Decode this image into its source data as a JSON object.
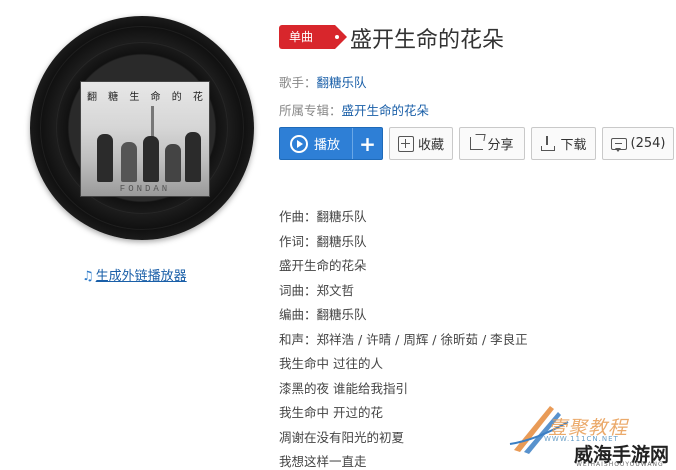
{
  "album_cover": {
    "title_text": "翻 糖 生 命 的 花 朵",
    "brand_text": "FONDAN"
  },
  "ext_player_link": "生成外链播放器",
  "song": {
    "badge": "单曲",
    "title": "盛开生命的花朵",
    "singer_label": "歌手：",
    "singer": "翻糖乐队",
    "album_label": "所属专辑：",
    "album": "盛开生命的花朵"
  },
  "actions": {
    "play": "播放",
    "add": "+",
    "favorite": "收藏",
    "share": "分享",
    "download": "下载",
    "comments": "(254)"
  },
  "lyrics": [
    "作曲：翻糖乐队",
    "作词：翻糖乐队",
    "盛开生命的花朵",
    "词曲：郑文哲",
    "编曲：翻糖乐队",
    "和声：郑祥浩 / 许晴 / 周辉 / 徐昕茹 / 李良正",
    "我生命中 过往的人",
    "漆黑的夜 谁能给我指引",
    "我生命中 开过的花",
    "凋谢在没有阳光的初夏",
    "我想这样一直走"
  ],
  "watermark": {
    "top": "壹聚教程",
    "url": "WWW.111CN.NET",
    "main": "威海手游网",
    "sub": "WEIHAISHOUYOUWANG"
  },
  "colors": {
    "accent_blue": "#2e7fd6",
    "badge_red": "#d8262c",
    "link_blue": "#1a5fa8"
  }
}
